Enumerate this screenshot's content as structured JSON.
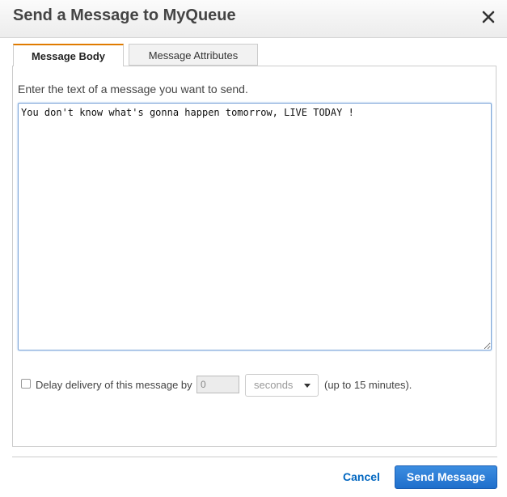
{
  "dialog": {
    "title": "Send a Message to MyQueue",
    "close_icon": "close-icon"
  },
  "tabs": [
    {
      "label": "Message Body",
      "active": true
    },
    {
      "label": "Message Attributes",
      "active": false
    }
  ],
  "body": {
    "prompt": "Enter the text of a message you want to send.",
    "message_text": "You don't know what's gonna happen tomorrow, LIVE TODAY !"
  },
  "delay": {
    "checked": false,
    "label": "Delay delivery of this message by",
    "value": "0",
    "unit": "seconds",
    "limit_note": "(up to 15 minutes)."
  },
  "footer": {
    "cancel_label": "Cancel",
    "send_label": "Send Message"
  },
  "colors": {
    "active_tab_accent": "#e07b00",
    "primary_button": "#1f6fcc",
    "link": "#0066c0"
  }
}
